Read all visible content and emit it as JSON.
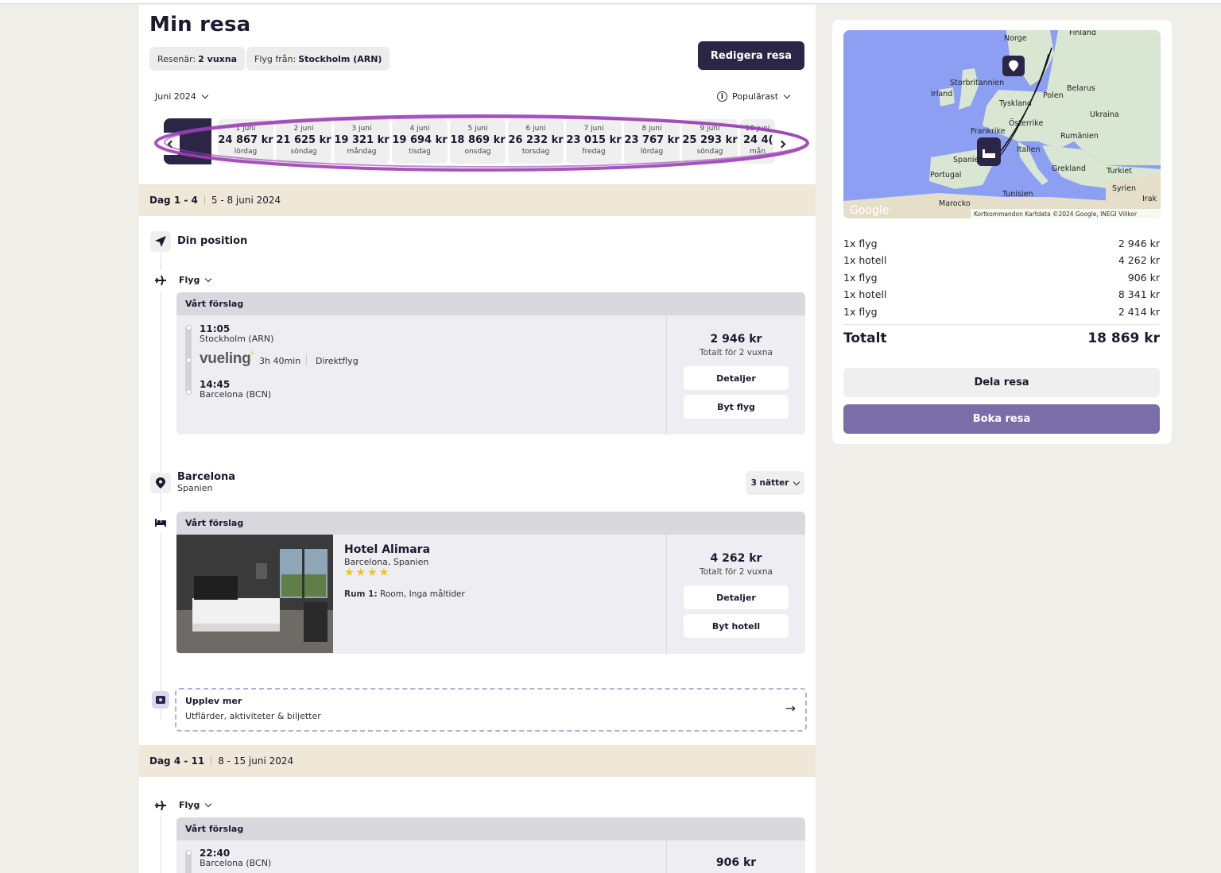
{
  "trip": {
    "title": "Min resa",
    "travelers_label": "Resenär:",
    "travelers_value": "2 vuxna",
    "from_label": "Flyg från:",
    "from_value": "Stockholm (ARN)",
    "edit_button": "Redigera resa",
    "month": "Juni 2024",
    "sort": "Populärast"
  },
  "dates": [
    {
      "date": "1 juni",
      "price": "24 867 kr",
      "weekday": "lördag"
    },
    {
      "date": "2 juni",
      "price": "21 625 kr",
      "weekday": "söndag"
    },
    {
      "date": "3 juni",
      "price": "19 321 kr",
      "weekday": "måndag"
    },
    {
      "date": "4 juni",
      "price": "19 694 kr",
      "weekday": "tisdag"
    },
    {
      "date": "5 juni",
      "price": "18 869 kr",
      "weekday": "onsdag"
    },
    {
      "date": "6 juni",
      "price": "26 232 kr",
      "weekday": "torsdag"
    },
    {
      "date": "7 juni",
      "price": "23 015 kr",
      "weekday": "fredag"
    },
    {
      "date": "8 juni",
      "price": "23 767 kr",
      "weekday": "lördag"
    },
    {
      "date": "9 juni",
      "price": "25 293 kr",
      "weekday": "söndag"
    },
    {
      "date": "10 juni",
      "price": "24 4(",
      "weekday": "mån"
    }
  ],
  "day1": {
    "label": "Dag 1 - 4",
    "range": "5 - 8 juni 2024"
  },
  "position": {
    "label": "Din position"
  },
  "flight1": {
    "section": "Flyg",
    "suggestion": "Vårt förslag",
    "dep_time": "11:05",
    "dep_city": "Stockholm (ARN)",
    "airline": "vueling",
    "duration": "3h 40min",
    "type": "Direktflyg",
    "arr_time": "14:45",
    "arr_city": "Barcelona (BCN)",
    "price": "2 946 kr",
    "price_sub": "Totalt för 2 vuxna",
    "details": "Detaljer",
    "change": "Byt flyg"
  },
  "destination": {
    "city": "Barcelona",
    "country": "Spanien",
    "nights": "3 nätter"
  },
  "hotel": {
    "suggestion": "Vårt förslag",
    "name": "Hotel Alimara",
    "location": "Barcelona, Spanien",
    "stars": "★★★★",
    "star_rating": 4,
    "room_label": "Rum 1:",
    "room_value": "Room, Inga måltider",
    "price": "4 262 kr",
    "price_sub": "Totalt för 2 vuxna",
    "details": "Detaljer",
    "change": "Byt hotell"
  },
  "extras": {
    "title": "Upplev mer",
    "subtitle": "Utflärder, aktiviteter & biljetter",
    "arrow": "→"
  },
  "day2": {
    "label": "Dag 4 - 11",
    "range": "8 - 15 juni 2024"
  },
  "flight2": {
    "section": "Flyg",
    "suggestion": "Vårt förslag",
    "dep_time": "22:40",
    "dep_city": "Barcelona (BCN)",
    "price": "906 kr"
  },
  "map": {
    "labels": [
      "Finland",
      "Norge",
      "Storbritannien",
      "Irland",
      "Belarus",
      "Tyskland",
      "Polen",
      "Ukraina",
      "Frankrike",
      "Österrike",
      "Rumänien",
      "Spanien",
      "Italien",
      "Portugal",
      "Grekland",
      "Turkiet",
      "Syrien",
      "Tunisien",
      "Marocko",
      "Irak"
    ],
    "google": "Google",
    "attribution": "Kortkommandon   Kartdata ©2024 Google, INEGI   Villkor"
  },
  "summary": {
    "rows": [
      {
        "label": "1x flyg",
        "value": "2 946 kr"
      },
      {
        "label": "1x hotell",
        "value": "4 262 kr"
      },
      {
        "label": "1x flyg",
        "value": "906 kr"
      },
      {
        "label": "1x hotell",
        "value": "8 341 kr"
      },
      {
        "label": "1x flyg",
        "value": "2 414 kr"
      }
    ],
    "total_label": "Totalt",
    "total_value": "18 869 kr",
    "share": "Dela resa",
    "book": "Boka resa"
  },
  "colors": {
    "primary": "#2b2546",
    "accent": "#7b6ea8",
    "highlight": "#9b3fb5",
    "band": "#efe8d8"
  }
}
